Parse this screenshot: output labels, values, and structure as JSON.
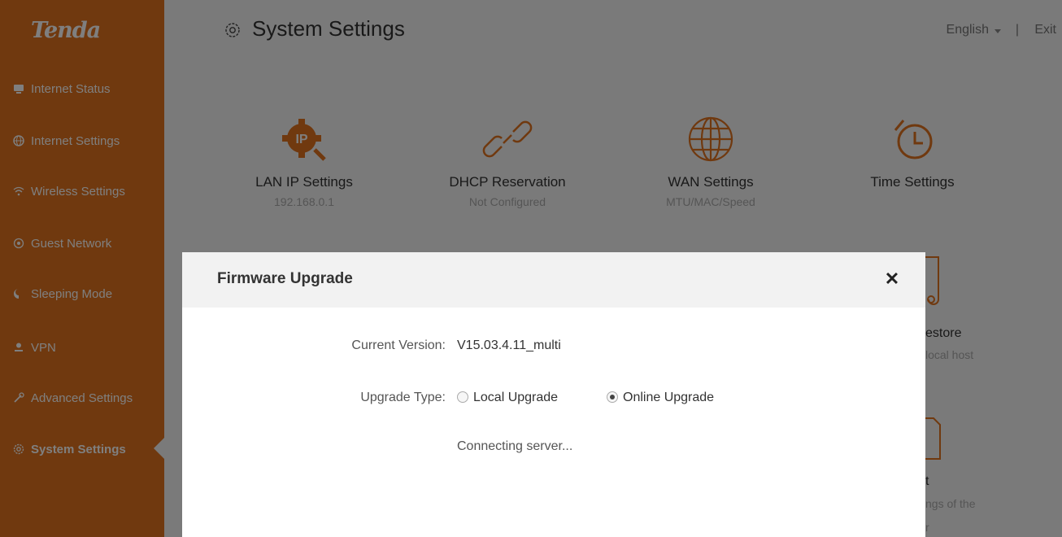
{
  "brand": {
    "logo_text": "Tenda",
    "accent_color": "#e0731e"
  },
  "sidebar": {
    "items": [
      {
        "label": "Internet Status",
        "icon": "monitor-icon"
      },
      {
        "label": "Internet Settings",
        "icon": "globe-icon"
      },
      {
        "label": "Wireless Settings",
        "icon": "wifi-icon"
      },
      {
        "label": "Guest Network",
        "icon": "guest-wifi-icon"
      },
      {
        "label": "Sleeping Mode",
        "icon": "moon-icon"
      },
      {
        "label": "VPN",
        "icon": "person-icon"
      },
      {
        "label": "Advanced Settings",
        "icon": "tools-icon"
      },
      {
        "label": "System Settings",
        "icon": "gear-icon",
        "active": true
      }
    ]
  },
  "header": {
    "title": "System Settings",
    "title_icon": "gear-icon",
    "language": "English",
    "separator": "|",
    "exit_label": "Exit"
  },
  "tiles": [
    {
      "label": "LAN IP Settings",
      "sub": "192.168.0.1",
      "icon": "ip-gear-icon"
    },
    {
      "label": "DHCP Reservation",
      "sub": "Not Configured",
      "icon": "link-icon"
    },
    {
      "label": "WAN Settings",
      "sub": "MTU/MAC/Speed",
      "icon": "globe-icon"
    },
    {
      "label": "Time Settings",
      "sub": "",
      "icon": "clock-icon"
    }
  ],
  "partial_tiles": [
    {
      "label": "estore",
      "sub": "local host"
    },
    {
      "label": "t",
      "sub": "ngs of the"
    },
    {
      "sub": "r"
    }
  ],
  "modal": {
    "title": "Firmware Upgrade",
    "close_icon": "close-icon",
    "current_version_label": "Current Version:",
    "current_version_value": "V15.03.4.11_multi",
    "upgrade_type_label": "Upgrade Type:",
    "options": [
      {
        "label": "Local Upgrade",
        "checked": false
      },
      {
        "label": "Online Upgrade",
        "checked": true
      }
    ],
    "status": "Connecting server..."
  }
}
